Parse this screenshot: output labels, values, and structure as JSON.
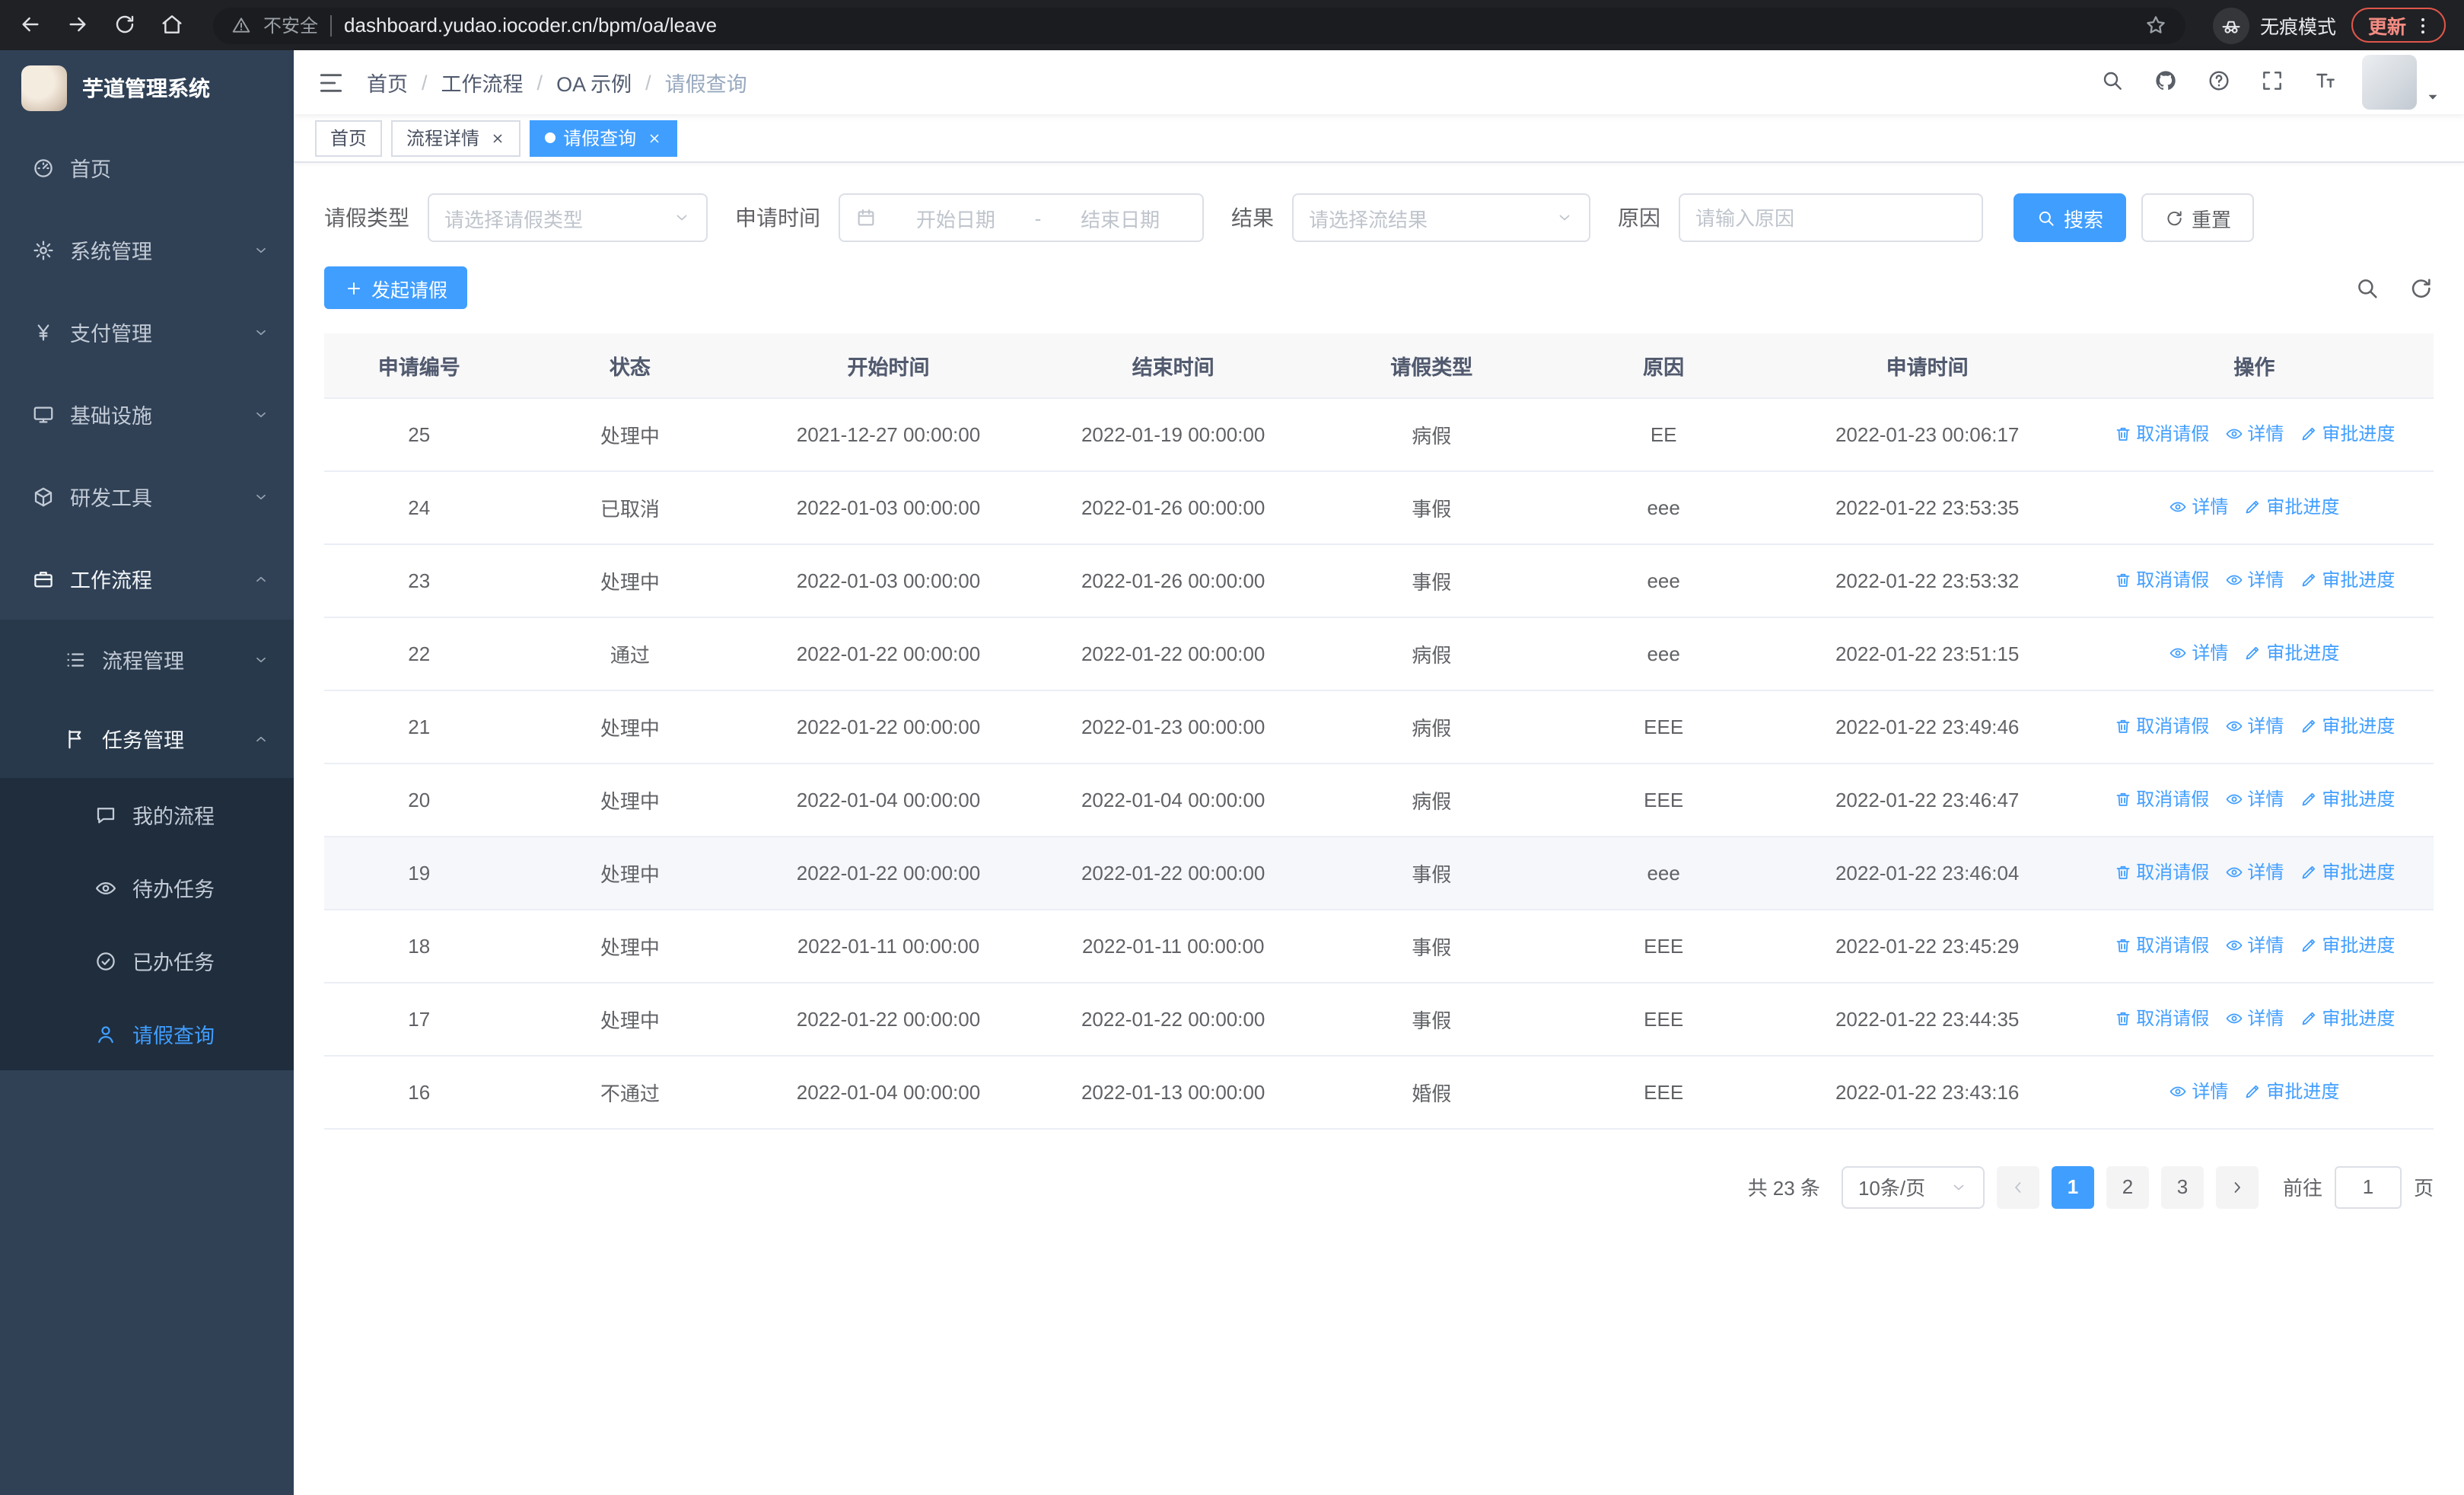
{
  "browser": {
    "nav_buttons": [
      {
        "name": "back",
        "icon": "arrow-left"
      },
      {
        "name": "forward",
        "icon": "arrow-right"
      },
      {
        "name": "reload",
        "icon": "reload"
      },
      {
        "name": "home",
        "icon": "home"
      }
    ],
    "security_label": "不安全",
    "url": "dashboard.yudao.iocoder.cn/bpm/oa/leave",
    "incognito_label": "无痕模式",
    "update_label": "更新"
  },
  "sidebar": {
    "logo_title": "芋道管理系统",
    "items": [
      {
        "label": "首页",
        "icon": "dashboard",
        "level": 0
      },
      {
        "label": "系统管理",
        "icon": "gear",
        "level": 0,
        "chevron": "down"
      },
      {
        "label": "支付管理",
        "icon": "yen",
        "level": 0,
        "chevron": "down"
      },
      {
        "label": "基础设施",
        "icon": "monitor",
        "level": 0,
        "chevron": "down"
      },
      {
        "label": "研发工具",
        "icon": "cube",
        "level": 0,
        "chevron": "down"
      },
      {
        "label": "工作流程",
        "icon": "briefcase",
        "level": 0,
        "chevron": "up",
        "open": true
      },
      {
        "label": "流程管理",
        "icon": "list",
        "level": 1,
        "chevron": "down"
      },
      {
        "label": "任务管理",
        "icon": "flag",
        "level": 1,
        "chevron": "up",
        "open": true
      },
      {
        "label": "我的流程",
        "icon": "chat",
        "level": 2
      },
      {
        "label": "待办任务",
        "icon": "eye",
        "level": 2
      },
      {
        "label": "已办任务",
        "icon": "check-badge",
        "level": 2
      },
      {
        "label": "请假查询",
        "icon": "user",
        "level": 2,
        "active": true
      }
    ]
  },
  "navbar": {
    "breadcrumb": [
      {
        "label": "首页"
      },
      {
        "label": "工作流程"
      },
      {
        "label": "OA 示例"
      },
      {
        "label": "请假查询",
        "muted": true
      }
    ],
    "actions": [
      {
        "name": "search",
        "icon": "search"
      },
      {
        "name": "github",
        "icon": "github"
      },
      {
        "name": "help",
        "icon": "question"
      },
      {
        "name": "fullscreen",
        "icon": "fullscreen"
      },
      {
        "name": "font-size",
        "icon": "fontsize"
      }
    ]
  },
  "tabs": [
    {
      "label": "首页",
      "closable": false,
      "active": false
    },
    {
      "label": "流程详情",
      "closable": true,
      "active": false
    },
    {
      "label": "请假查询",
      "closable": true,
      "active": true
    }
  ],
  "filters": {
    "leave_type_label": "请假类型",
    "leave_type_placeholder": "请选择请假类型",
    "apply_time_label": "申请时间",
    "start_date_placeholder": "开始日期",
    "date_separator": "-",
    "end_date_placeholder": "结束日期",
    "result_label": "结果",
    "result_placeholder": "请选择流结果",
    "reason_label": "原因",
    "reason_placeholder": "请输入原因",
    "search_button": "搜索",
    "reset_button": "重置"
  },
  "toolbar": {
    "create_button": "发起请假",
    "right_tools": [
      {
        "name": "toggle-search",
        "icon": "search"
      },
      {
        "name": "refresh-table",
        "icon": "refresh"
      }
    ]
  },
  "table": {
    "columns": [
      "申请编号",
      "状态",
      "开始时间",
      "结束时间",
      "请假类型",
      "原因",
      "申请时间",
      "操作"
    ],
    "op_labels": {
      "cancel": "取消请假",
      "detail": "详情",
      "progress": "审批进度"
    },
    "op_icons": {
      "cancel": "trash",
      "detail": "eye",
      "progress": "edit"
    },
    "rows": [
      {
        "id": "25",
        "status": "处理中",
        "start": "2021-12-27 00:00:00",
        "end": "2022-01-19 00:00:00",
        "type": "病假",
        "reason": "EE",
        "applied": "2022-01-23 00:06:17",
        "ops": [
          "cancel",
          "detail",
          "progress"
        ]
      },
      {
        "id": "24",
        "status": "已取消",
        "start": "2022-01-03 00:00:00",
        "end": "2022-01-26 00:00:00",
        "type": "事假",
        "reason": "eee",
        "applied": "2022-01-22 23:53:35",
        "ops": [
          "detail",
          "progress"
        ]
      },
      {
        "id": "23",
        "status": "处理中",
        "start": "2022-01-03 00:00:00",
        "end": "2022-01-26 00:00:00",
        "type": "事假",
        "reason": "eee",
        "applied": "2022-01-22 23:53:32",
        "ops": [
          "cancel",
          "detail",
          "progress"
        ]
      },
      {
        "id": "22",
        "status": "通过",
        "start": "2022-01-22 00:00:00",
        "end": "2022-01-22 00:00:00",
        "type": "病假",
        "reason": "eee",
        "applied": "2022-01-22 23:51:15",
        "ops": [
          "detail",
          "progress"
        ]
      },
      {
        "id": "21",
        "status": "处理中",
        "start": "2022-01-22 00:00:00",
        "end": "2022-01-23 00:00:00",
        "type": "病假",
        "reason": "EEE",
        "applied": "2022-01-22 23:49:46",
        "ops": [
          "cancel",
          "detail",
          "progress"
        ]
      },
      {
        "id": "20",
        "status": "处理中",
        "start": "2022-01-04 00:00:00",
        "end": "2022-01-04 00:00:00",
        "type": "病假",
        "reason": "EEE",
        "applied": "2022-01-22 23:46:47",
        "ops": [
          "cancel",
          "detail",
          "progress"
        ]
      },
      {
        "id": "19",
        "status": "处理中",
        "start": "2022-01-22 00:00:00",
        "end": "2022-01-22 00:00:00",
        "type": "事假",
        "reason": "eee",
        "applied": "2022-01-22 23:46:04",
        "ops": [
          "cancel",
          "detail",
          "progress"
        ],
        "highlight": true
      },
      {
        "id": "18",
        "status": "处理中",
        "start": "2022-01-11 00:00:00",
        "end": "2022-01-11 00:00:00",
        "type": "事假",
        "reason": "EEE",
        "applied": "2022-01-22 23:45:29",
        "ops": [
          "cancel",
          "detail",
          "progress"
        ]
      },
      {
        "id": "17",
        "status": "处理中",
        "start": "2022-01-22 00:00:00",
        "end": "2022-01-22 00:00:00",
        "type": "事假",
        "reason": "EEE",
        "applied": "2022-01-22 23:44:35",
        "ops": [
          "cancel",
          "detail",
          "progress"
        ]
      },
      {
        "id": "16",
        "status": "不通过",
        "start": "2022-01-04 00:00:00",
        "end": "2022-01-13 00:00:00",
        "type": "婚假",
        "reason": "EEE",
        "applied": "2022-01-22 23:43:16",
        "ops": [
          "detail",
          "progress"
        ]
      }
    ]
  },
  "pagination": {
    "total_label": "共 23 条",
    "page_size": "10条/页",
    "pages": [
      "1",
      "2",
      "3"
    ],
    "active_page": "1",
    "goto_label": "前往",
    "goto_value": "1",
    "page_suffix": "页"
  },
  "colors": {
    "primary": "#409eff",
    "sidebar_bg": "#304156",
    "sidebar_submenu_bg": "#1f2d3d",
    "browser_bar_bg": "#202124",
    "update_chip_text": "#f28b82"
  }
}
